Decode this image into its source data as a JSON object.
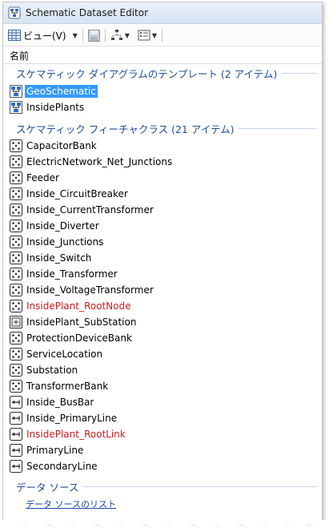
{
  "window": {
    "title": "Schematic Dataset Editor"
  },
  "toolbar": {
    "view_label": "ビュー(V)"
  },
  "column_header": {
    "name": "名前"
  },
  "groups": {
    "templates": {
      "label": "スケマティック ダイアグラムのテンプレート (2 アイテム)"
    },
    "feature_classes": {
      "label": "スケマティック フィーチャクラス (21 アイテム)"
    },
    "data_sources": {
      "label": "データ ソース",
      "link": "データ ソースのリスト"
    }
  },
  "templates": [
    {
      "label": "GeoSchematic",
      "icon": "diagram-template-icon",
      "selected": true
    },
    {
      "label": "InsidePlants",
      "icon": "diagram-template-icon"
    }
  ],
  "feature_classes": [
    {
      "label": "CapacitorBank",
      "icon": "node-icon"
    },
    {
      "label": "ElectricNetwork_Net_Junctions",
      "icon": "node-icon"
    },
    {
      "label": "Feeder",
      "icon": "node-icon"
    },
    {
      "label": "Inside_CircuitBreaker",
      "icon": "node-icon"
    },
    {
      "label": "Inside_CurrentTransformer",
      "icon": "node-icon"
    },
    {
      "label": "Inside_Diverter",
      "icon": "node-icon"
    },
    {
      "label": "Inside_Junctions",
      "icon": "node-icon"
    },
    {
      "label": "Inside_Switch",
      "icon": "node-icon"
    },
    {
      "label": "Inside_Transformer",
      "icon": "node-icon"
    },
    {
      "label": "Inside_VoltageTransformer",
      "icon": "node-icon"
    },
    {
      "label": "InsidePlant_RootNode",
      "icon": "node-icon",
      "red": true
    },
    {
      "label": "InsidePlant_SubStation",
      "icon": "node-on-link-icon"
    },
    {
      "label": "ProtectionDeviceBank",
      "icon": "node-icon"
    },
    {
      "label": "ServiceLocation",
      "icon": "node-icon"
    },
    {
      "label": "Substation",
      "icon": "node-icon"
    },
    {
      "label": "TransformerBank",
      "icon": "node-icon"
    },
    {
      "label": "Inside_BusBar",
      "icon": "link-icon"
    },
    {
      "label": "Inside_PrimaryLine",
      "icon": "link-icon"
    },
    {
      "label": "InsidePlant_RootLink",
      "icon": "link-icon",
      "red": true
    },
    {
      "label": "PrimaryLine",
      "icon": "link-icon"
    },
    {
      "label": "SecondaryLine",
      "icon": "link-icon"
    }
  ],
  "colors": {
    "group_header": "#1f4e9a",
    "red_item": "#d21a1a",
    "selection": "#3399ff"
  }
}
